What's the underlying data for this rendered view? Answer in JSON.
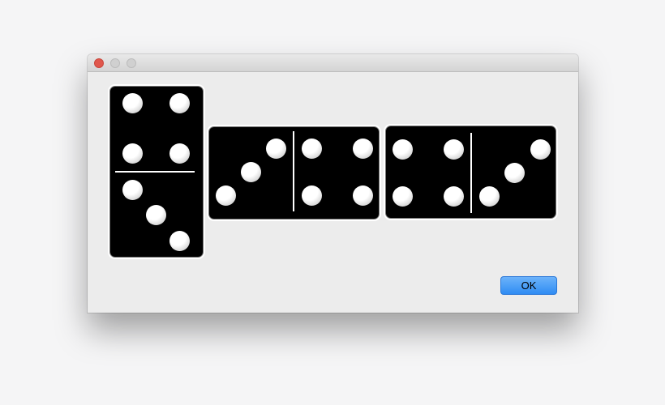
{
  "window": {
    "title_bar_buttons": [
      {
        "name": "close",
        "color": "#e0574c"
      },
      {
        "name": "minimize",
        "color": "#d0d0d0"
      },
      {
        "name": "zoom",
        "color": "#d0d0d0"
      }
    ]
  },
  "dominoes": [
    {
      "orientation": "vertical",
      "halves": [
        4,
        3
      ]
    },
    {
      "orientation": "horizontal",
      "halves": [
        3,
        4
      ]
    },
    {
      "orientation": "horizontal",
      "halves": [
        4,
        3
      ]
    }
  ],
  "dialog": {
    "ok_label": "OK"
  },
  "colors": {
    "domino_face": "#000000",
    "pip": "#ffffff",
    "accent_button": "#2f8cf3"
  }
}
